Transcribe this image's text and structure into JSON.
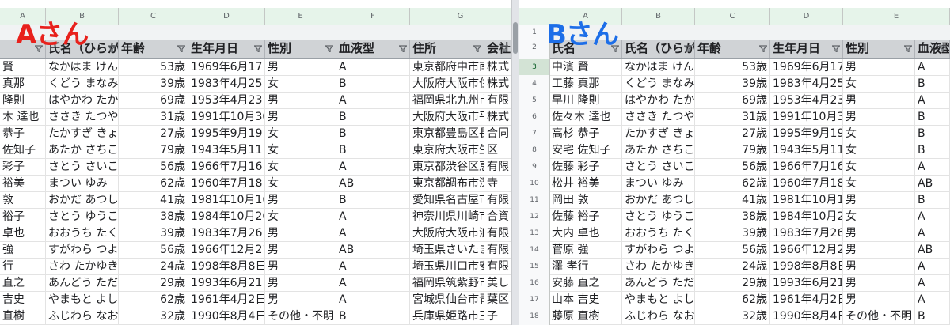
{
  "labels": {
    "a": "Aさん",
    "b": "Bさん"
  },
  "paneA": {
    "columns": [
      "A",
      "B",
      "C",
      "D",
      "E",
      "F",
      "G"
    ],
    "headers": [
      "",
      "氏名（ひらがな）",
      "年齢",
      "生年月日",
      "性別",
      "血液型",
      "住所",
      "会社"
    ],
    "rows": [
      [
        "賢",
        "なかはま けん",
        "53歳",
        "1969年6月17日",
        "男",
        "A",
        "東京都府中市南",
        "株式"
      ],
      [
        "真那",
        "くどう まなみ",
        "39歳",
        "1983年4月25日",
        "女",
        "B",
        "大阪府大阪市住",
        "株式"
      ],
      [
        "隆則",
        "はやかわ たかの",
        "69歳",
        "1953年4月23日",
        "男",
        "A",
        "福岡県北九州市小",
        "有限"
      ],
      [
        "木 達也",
        "ささき たつや",
        "31歳",
        "1991年10月30",
        "男",
        "B",
        "大阪府大阪市平",
        "株式"
      ],
      [
        "恭子",
        "たかすぎ きょう",
        "27歳",
        "1995年9月19日",
        "女",
        "B",
        "東京都豊島区長",
        "合同"
      ],
      [
        "佐知子",
        "あたか さちこ",
        "79歳",
        "1943年5月11日",
        "女",
        "B",
        "東京府大阪市生野",
        "区"
      ],
      [
        "彩子",
        "さとう さいこ",
        "56歳",
        "1966年7月16日",
        "女",
        "A",
        "東京都渋谷区恵",
        "有限"
      ],
      [
        "裕美",
        "まつい ゆみ",
        "62歳",
        "1960年7月18日",
        "女",
        "AB",
        "東京都調布市深大",
        "寺"
      ],
      [
        "敦",
        "おかだ あつし",
        "41歳",
        "1981年10月16",
        "男",
        "B",
        "愛知県名古屋市",
        "有限"
      ],
      [
        "裕子",
        "さとう ゆうこ",
        "38歳",
        "1984年10月20",
        "女",
        "A",
        "神奈川県川崎市",
        "合資"
      ],
      [
        "卓也",
        "おおうち たくや",
        "39歳",
        "1983年7月26日",
        "男",
        "A",
        "大阪府大阪市浪",
        "有限"
      ],
      [
        "強",
        "すがわら つよし",
        "56歳",
        "1966年12月21",
        "男",
        "AB",
        "埼玉県さいたま",
        "有限"
      ],
      [
        "行",
        "さわ たかゆき",
        "24歳",
        "1998年8月8日",
        "男",
        "A",
        "埼玉県川口市安",
        "有限"
      ],
      [
        "直之",
        "あんどう ただゆ",
        "29歳",
        "1993年6月21日",
        "男",
        "A",
        "福岡県筑紫野市",
        "美し"
      ],
      [
        "吉史",
        "やまもと よしふ",
        "62歳",
        "1961年4月2日",
        "男",
        "A",
        "宮城県仙台市青",
        "葉区"
      ],
      [
        "直樹",
        "ふじわら なおき",
        "32歳",
        "1990年8月4日",
        "その他・不明",
        "B",
        "兵庫県姫路市王",
        "子"
      ]
    ]
  },
  "paneB": {
    "columns": [
      "A",
      "B",
      "C",
      "D",
      "E"
    ],
    "rownums": [
      "1",
      "2",
      "3",
      "4",
      "5",
      "6",
      "7",
      "8",
      "9",
      "10",
      "11",
      "12",
      "13",
      "14",
      "15",
      "16",
      "17",
      "18"
    ],
    "headers": [
      "氏名",
      "氏名（ひらがな）",
      "年齢",
      "生年月日",
      "性別",
      "血液型"
    ],
    "rows": [
      [
        "中濱 賢",
        "なかはま けん",
        "53歳",
        "1969年6月17日",
        "男",
        "A"
      ],
      [
        "工藤 真那",
        "くどう まなみ",
        "39歳",
        "1983年4月25日",
        "女",
        "B"
      ],
      [
        "早川 隆則",
        "はやかわ たかの",
        "69歳",
        "1953年4月23日",
        "男",
        "A"
      ],
      [
        "佐々木 達也",
        "ささき たつや",
        "31歳",
        "1991年10月30",
        "男",
        "B"
      ],
      [
        "高杉 恭子",
        "たかすぎ きょう",
        "27歳",
        "1995年9月19日",
        "女",
        "B"
      ],
      [
        "安宅 佐知子",
        "あたか さちこ",
        "79歳",
        "1943年5月11日",
        "女",
        "B"
      ],
      [
        "佐藤 彩子",
        "さとう さいこ",
        "56歳",
        "1966年7月16日",
        "女",
        "A"
      ],
      [
        "松井 裕美",
        "まつい ゆみ",
        "62歳",
        "1960年7月18日",
        "女",
        "AB"
      ],
      [
        "岡田 敦",
        "おかだ あつし",
        "41歳",
        "1981年10月16",
        "男",
        "B"
      ],
      [
        "佐藤 裕子",
        "さとう ゆうこ",
        "38歳",
        "1984年10月20",
        "女",
        "A"
      ],
      [
        "大内 卓也",
        "おおうち たくや",
        "39歳",
        "1983年7月26日",
        "男",
        "A"
      ],
      [
        "菅原 強",
        "すがわら つよし",
        "56歳",
        "1966年12月21",
        "男",
        "AB"
      ],
      [
        "澤 孝行",
        "さわ たかゆき",
        "24歳",
        "1998年8月8日",
        "男",
        "A"
      ],
      [
        "安藤 直之",
        "あんどう ただゆ",
        "29歳",
        "1993年6月21日",
        "男",
        "A"
      ],
      [
        "山本 吉史",
        "やまもと よしふ",
        "62歳",
        "1961年4月2日",
        "男",
        "A"
      ],
      [
        "藤原 直樹",
        "ふじわら なおき",
        "32歳",
        "1990年8月4日",
        "その他・不明",
        "B"
      ]
    ]
  },
  "colors": {
    "labelA": "#e8211c",
    "labelB": "#1d6ee8",
    "headerBg": "#d0d3d6",
    "colHeadBg": "#e6f4ea"
  },
  "icons": {
    "filter": "filter-icon"
  }
}
